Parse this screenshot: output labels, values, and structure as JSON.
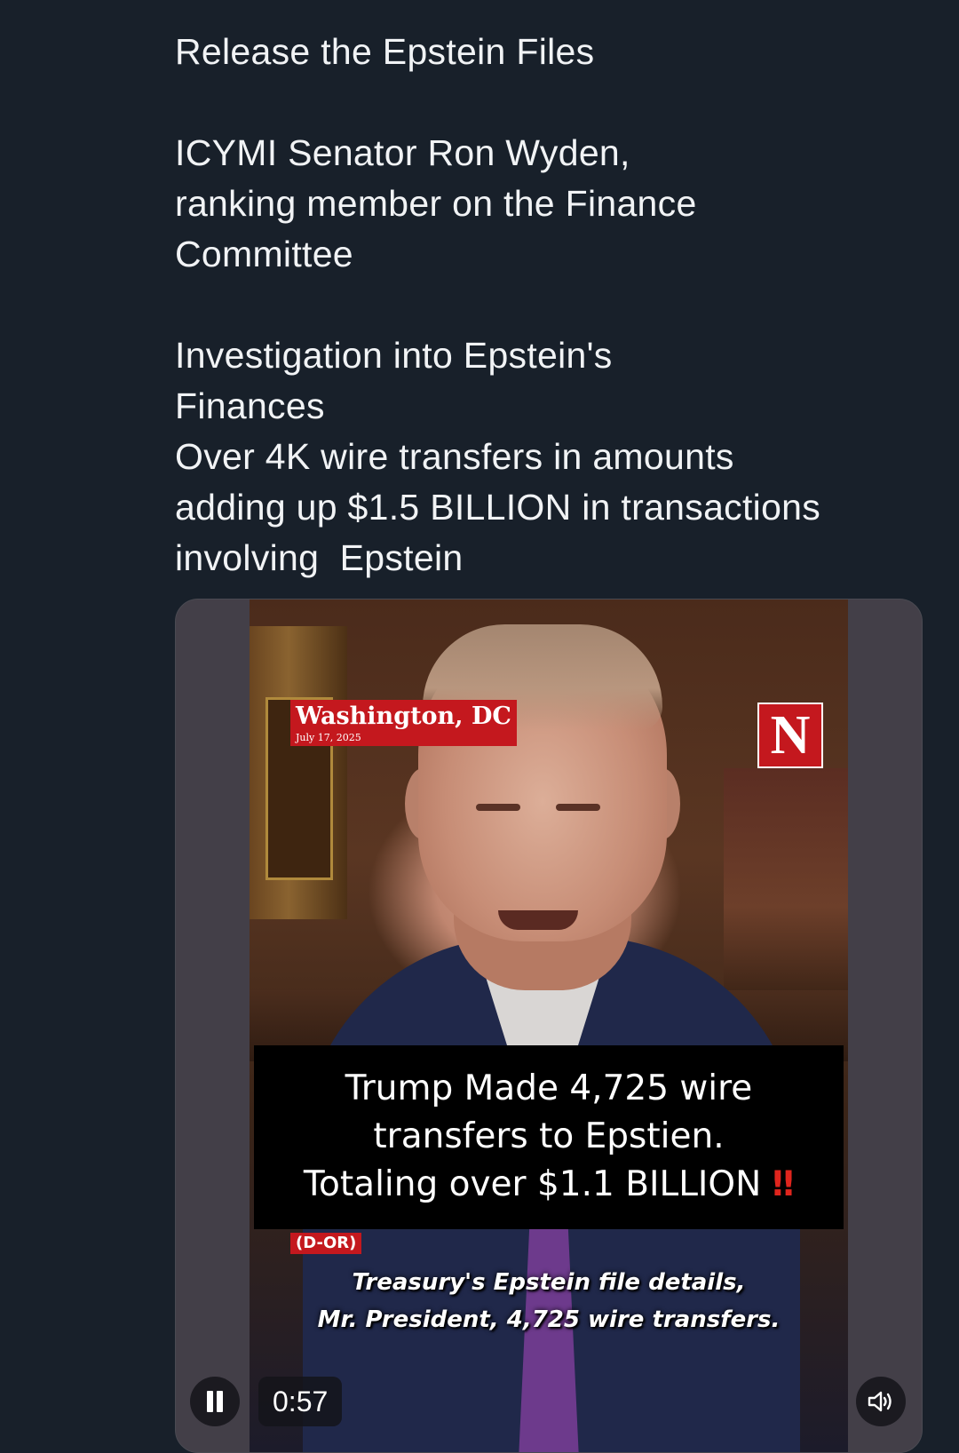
{
  "post": {
    "line1": "Release the Epstein Files",
    "para2": [
      "ICYMI Senator Ron Wyden,",
      "ranking member on the Finance",
      "Committee"
    ],
    "para3": [
      "Investigation into Epstein's",
      "Finances",
      "Over 4K wire transfers in amounts",
      "adding up $1.5 BILLION in transactions",
      "involving  Epstein"
    ]
  },
  "video": {
    "location_title": "Washington, DC",
    "location_date": "July 17, 2025",
    "brand_logo": "N",
    "caption_lines": [
      "Trump Made 4,725 wire",
      "transfers to Epstien.",
      "Totaling over $1.1 BILLION"
    ],
    "caption_emphasis": "‼",
    "party_tag": "(D-OR)",
    "subtitle_lines": [
      "Treasury's Epstein file details,",
      "Mr. President, 4,725 wire transfers."
    ],
    "time": "0:57",
    "pause_icon": "pause-icon",
    "volume_icon": "volume-icon"
  },
  "colors": {
    "background": "#18202a",
    "text": "#f1f3f5",
    "brand_red": "#c4181e"
  }
}
